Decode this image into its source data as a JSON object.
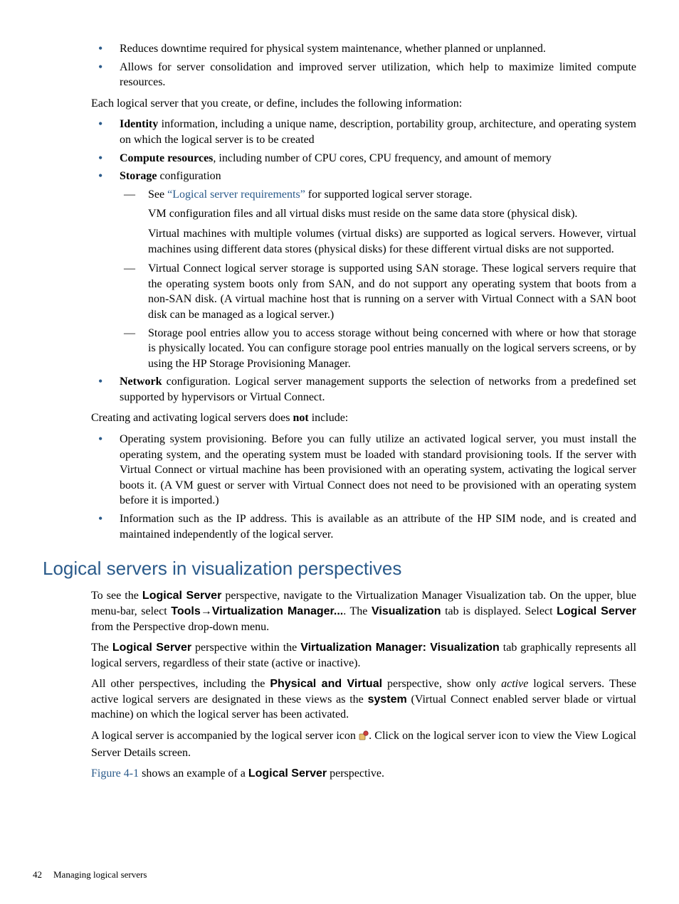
{
  "bullets_top": [
    "Reduces downtime required for physical system maintenance, whether planned or unplanned.",
    "Allows for server consolidation and improved server utilization, which help to maximize limited compute resources."
  ],
  "para_define": "Each logical server that you create, or define, includes the following information:",
  "identity": {
    "bold": "Identity",
    "rest": " information, including a unique name, description, portability group, architecture, and operating system on which the logical server is to be created"
  },
  "compute": {
    "bold": "Compute resources",
    "rest": ", including number of CPU cores, CPU frequency, and amount of memory"
  },
  "storage": {
    "bold": "Storage",
    "rest": "  configuration",
    "d1_pre": "See ",
    "d1_link": "“Logical server requirements”",
    "d1_post": " for supported logical server storage.",
    "d1_sub1": "VM configuration files and all virtual disks must reside on the same data store (physical disk).",
    "d1_sub2": "Virtual machines with multiple volumes (virtual disks) are supported as logical servers. However, virtual machines using different data stores (physical disks) for these different virtual disks are not supported.",
    "d2": "Virtual Connect logical server storage is supported using SAN storage. These logical servers require that the operating system boots only from SAN, and do not support any operating system that boots from a non-SAN disk. (A virtual machine host that is running on a server with Virtual Connect with a SAN boot disk can be managed as a logical server.)",
    "d3": "Storage pool entries allow you to access storage without being concerned with where or how that storage is physically located. You can configure storage pool entries manually on the logical servers screens, or by using the HP Storage Provisioning Manager."
  },
  "network": {
    "bold": "Network",
    "rest": " configuration. Logical server management supports the selection of networks from a predefined set supported by hypervisors or Virtual Connect."
  },
  "para_not_pre": "Creating and activating logical servers does ",
  "para_not_bold": "not",
  "para_not_post": " include:",
  "not_bullets": [
    "Operating system provisioning. Before you can fully utilize an activated logical server, you must install the operating system, and the operating system must be loaded with standard provisioning tools. If the server with Virtual Connect or virtual machine has been provisioned with an operating system, activating the logical server boots it. (A VM guest or server with Virtual Connect does not need to be provisioned with an operating system before it is imported.)",
    "Information such as the IP address. This is available as an attribute of the HP SIM node, and is created and maintained independently of the logical server."
  ],
  "section_heading": "Logical servers in visualization perspectives",
  "p1": {
    "t1": "To see the ",
    "b1": "Logical Server",
    "t2": " perspective, navigate to the Virtualization Manager Visualization tab. On the upper, blue menu-bar, select ",
    "b2": "Tools",
    "arrow": "→",
    "b3": "Virtualization Manager...",
    "t3": ". The ",
    "b4": "Visualization",
    "t4": " tab is displayed. Select ",
    "b5": "Logical Server",
    "t5": " from the Perspective drop-down menu."
  },
  "p2": {
    "t1": "The ",
    "b1": "Logical Server",
    "t2": " perspective within the ",
    "b2": "Virtualization Manager: Visualization",
    "t3": " tab graphically represents all logical servers, regardless of their state (active or inactive)."
  },
  "p3": {
    "t1": "All other perspectives, including the ",
    "b1": "Physical and Virtual",
    "t2": " perspective, show only ",
    "i1": "active",
    "t3": " logical servers. These active logical servers are designated in these views as the ",
    "b2": "system",
    "t4": " (Virtual Connect enabled server blade or virtual machine) on which the logical server has been activated."
  },
  "p4": {
    "t1": "A logical server is accompanied by the logical server icon ",
    "t2": ". Click on the logical server icon to view the View Logical Server Details screen."
  },
  "p5": {
    "link": "Figure 4-1",
    "t1": " shows an example of a ",
    "b1": "Logical Server",
    "t2": " perspective."
  },
  "footer": {
    "page": "42",
    "chapter": "Managing logical servers"
  }
}
